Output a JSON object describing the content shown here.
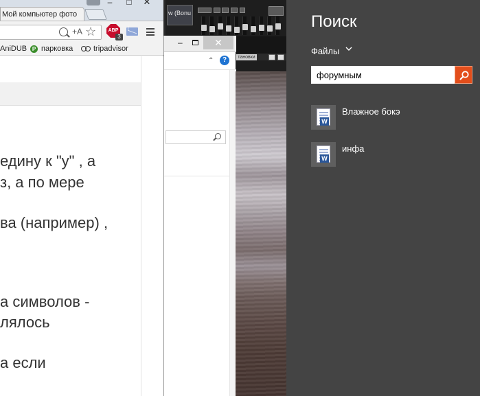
{
  "browser": {
    "tab_title": "Мой компьютер фото",
    "window_controls": {
      "minimize": "–",
      "maximize": "□",
      "close": "✕"
    },
    "toolbar": {
      "translate_label": "+A",
      "abp_label": "ABP",
      "abp_count": "3"
    },
    "bookmarks": [
      {
        "label": "AniDUB"
      },
      {
        "label": "парковка",
        "icon_letter": "P"
      },
      {
        "label": "tripadvisor"
      }
    ],
    "page_lines": [
      "едину к \"у\" , а",
      "з, а по мере",
      "ва (например) ,",
      "а символов -",
      "лялось",
      "а если"
    ]
  },
  "explorer": {
    "minimize": "–",
    "close": "✕",
    "help": "?",
    "chevron": "⌃"
  },
  "audio_app": {
    "display_text": "w (Bonu",
    "button_text": "тановки"
  },
  "search_charm": {
    "title": "Поиск",
    "scope": "Файлы",
    "query": "форумным",
    "results": [
      {
        "label": "Влажное бокэ",
        "type_icon": "word-document-icon",
        "type_letter": "W"
      },
      {
        "label": "инфа",
        "type_icon": "word-document-icon",
        "type_letter": "W"
      }
    ],
    "accent_color": "#e34e1b"
  }
}
